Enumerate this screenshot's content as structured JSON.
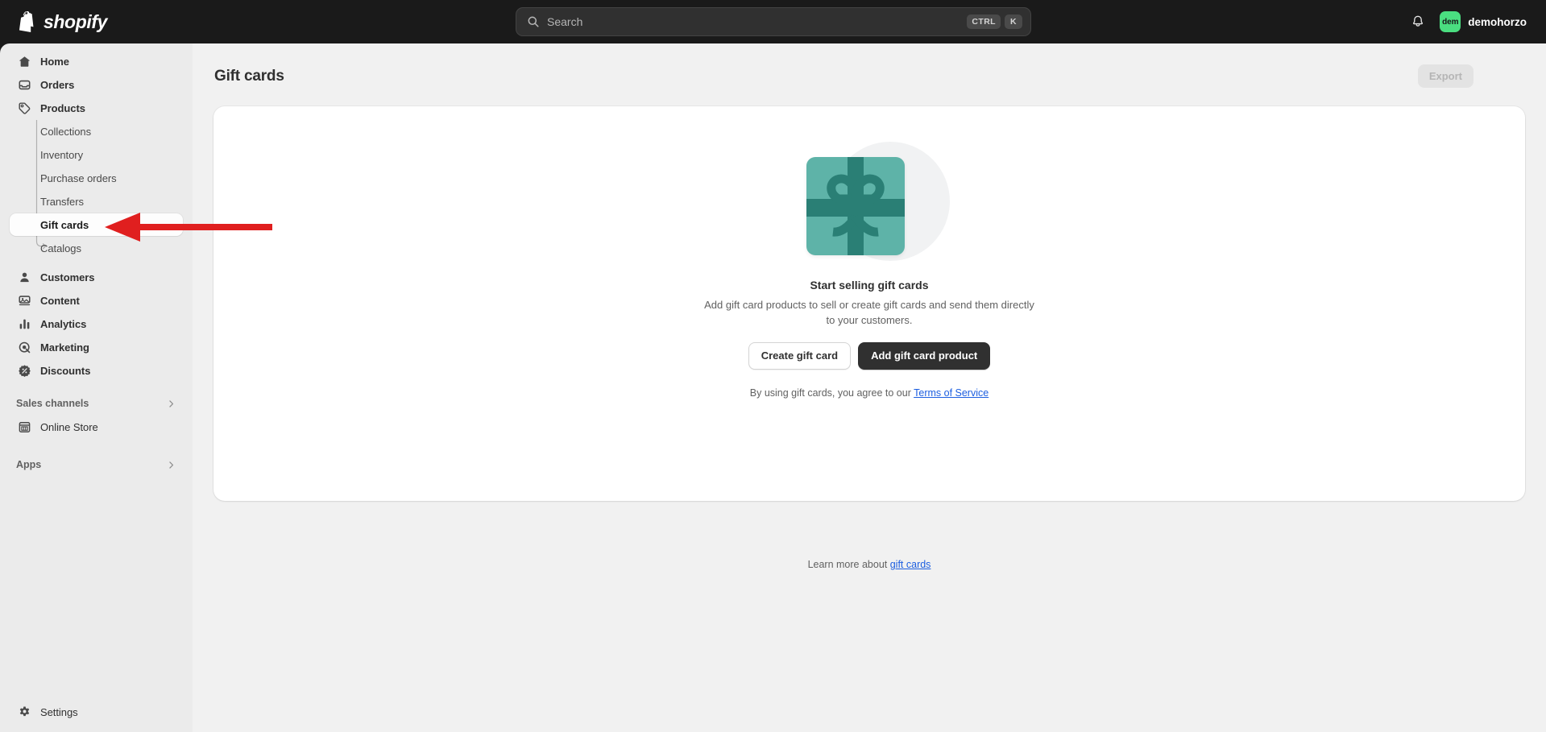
{
  "topbar": {
    "brand_name": "shopify",
    "brand_logo_icon": "shopify-bag-logo",
    "search": {
      "placeholder": "Search",
      "value": "",
      "icon": "search-icon",
      "shortcut_modifier": "CTRL",
      "shortcut_key": "K"
    },
    "notifications_icon": "bell-icon",
    "user": {
      "avatar_initials": "dem",
      "avatar_color": "#4ade80",
      "name": "demohorzo"
    }
  },
  "sidebar": {
    "items": [
      {
        "label": "Home",
        "icon": "home-icon",
        "level": 0,
        "active": false
      },
      {
        "label": "Orders",
        "icon": "orders-icon",
        "level": 0,
        "active": false
      },
      {
        "label": "Products",
        "icon": "products-tag-icon",
        "level": 0,
        "active": false
      },
      {
        "label": "Collections",
        "icon": "",
        "level": 1,
        "active": false
      },
      {
        "label": "Inventory",
        "icon": "",
        "level": 1,
        "active": false
      },
      {
        "label": "Purchase orders",
        "icon": "",
        "level": 1,
        "active": false
      },
      {
        "label": "Transfers",
        "icon": "",
        "level": 1,
        "active": false
      },
      {
        "label": "Gift cards",
        "icon": "",
        "level": 1,
        "active": true
      },
      {
        "label": "Catalogs",
        "icon": "",
        "level": 1,
        "active": false
      },
      {
        "label": "Customers",
        "icon": "customers-icon",
        "level": 0,
        "active": false
      },
      {
        "label": "Content",
        "icon": "content-icon",
        "level": 0,
        "active": false
      },
      {
        "label": "Analytics",
        "icon": "analytics-bars-icon",
        "level": 0,
        "active": false
      },
      {
        "label": "Marketing",
        "icon": "marketing-target-icon",
        "level": 0,
        "active": false
      },
      {
        "label": "Discounts",
        "icon": "discounts-percent-icon",
        "level": 0,
        "active": false
      }
    ],
    "sales_channels": {
      "label": "Sales channels",
      "chevron_icon": "chevron-right-icon",
      "items": [
        {
          "label": "Online Store",
          "icon": "store-icon"
        }
      ]
    },
    "apps": {
      "label": "Apps",
      "chevron_icon": "chevron-right-icon"
    },
    "settings": {
      "label": "Settings",
      "icon": "gear-icon"
    }
  },
  "page": {
    "title": "Gift cards",
    "export_label": "Export",
    "export_disabled": true,
    "empty_state": {
      "illustration_icon": "gift-card-bow-illustration",
      "illustration_color": "#5eb3a8",
      "illustration_ribbon_color": "#2a7f75",
      "title": "Start selling gift cards",
      "body": "Add gift card products to sell or create gift cards and send them directly to your customers.",
      "secondary_button": "Create gift card",
      "primary_button": "Add gift card product",
      "tos_prefix": "By using gift cards, you agree to our ",
      "tos_link": "Terms of Service"
    },
    "footer": {
      "prefix": "Learn more about ",
      "link": "gift cards"
    }
  },
  "annotation": {
    "arrow_color": "#e01f1f",
    "points_to": "sidebar-item-gift-cards"
  }
}
